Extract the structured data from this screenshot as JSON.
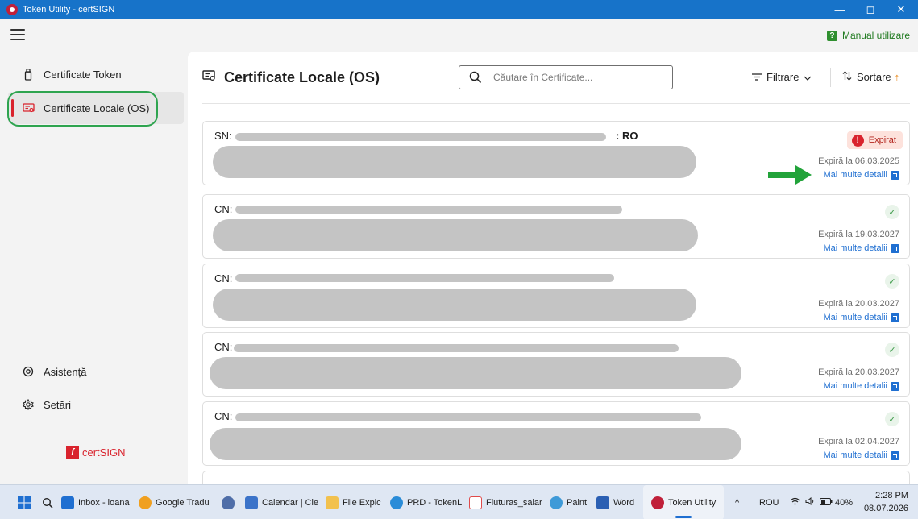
{
  "window": {
    "title": "Token Utility - certSIGN",
    "controls": [
      "—",
      "◻",
      "✕"
    ]
  },
  "appbar": {
    "manual_label": "Manual utilizare",
    "manual_icon": "?"
  },
  "sidebar": {
    "items": [
      {
        "label": "Certificate Token",
        "icon": "token-icon"
      },
      {
        "label": "Certificate Locale (OS)",
        "icon": "certificate-icon"
      }
    ],
    "bottom": [
      {
        "label": "Asistență",
        "icon": "support-icon"
      },
      {
        "label": "Setări",
        "icon": "gear-icon"
      }
    ],
    "brand": "certSIGN"
  },
  "main": {
    "title": "Certificate Locale (OS)",
    "search_placeholder": "Căutare în Certificate...",
    "filter_label": "Filtrare",
    "sort_label": "Sortare",
    "details_label": "Mai multe detalii",
    "cards": [
      {
        "cn_prefix": "SN:",
        "cn_tail": ": RO",
        "status": "Expirat",
        "expiry": "Expiră la 06.03.2025"
      },
      {
        "cn_prefix": "CN:",
        "cn_tail": "",
        "status": "ok",
        "expiry": "Expiră la 19.03.2027"
      },
      {
        "cn_prefix": "CN:",
        "cn_tail": "",
        "status": "ok",
        "expiry": "Expiră la 20.03.2027"
      },
      {
        "cn_prefix": "CN:",
        "cn_tail": "",
        "status": "ok",
        "expiry": "Expiră la 20.03.2027"
      },
      {
        "cn_prefix": "CN:",
        "cn_tail": "",
        "status": "ok",
        "expiry": "Expiră la 02.04.2027"
      }
    ]
  },
  "taskbar": {
    "apps": [
      {
        "label": "Inbox - ioana",
        "color": "#1f6fd1"
      },
      {
        "label": "Google Tradu",
        "color": "#f0a020"
      },
      {
        "label": "",
        "color": "#4f6ea8"
      },
      {
        "label": "Calendar | Cle",
        "color": "#3b73c9"
      },
      {
        "label": "File Explc",
        "color": "#f2c14e"
      },
      {
        "label": "PRD - TokenL",
        "color": "#2a8cd8"
      },
      {
        "label": "Fluturas_salar",
        "color": "#e04b4b"
      },
      {
        "label": "Paint",
        "color": "#3e9ad8"
      },
      {
        "label": "Word",
        "color": "#2b5fb3"
      },
      {
        "label": "Token Utility",
        "color": "#c0203a"
      }
    ],
    "language": "ROU",
    "battery": "40%",
    "time": "2:28 PM",
    "date": "08.07.2026"
  }
}
